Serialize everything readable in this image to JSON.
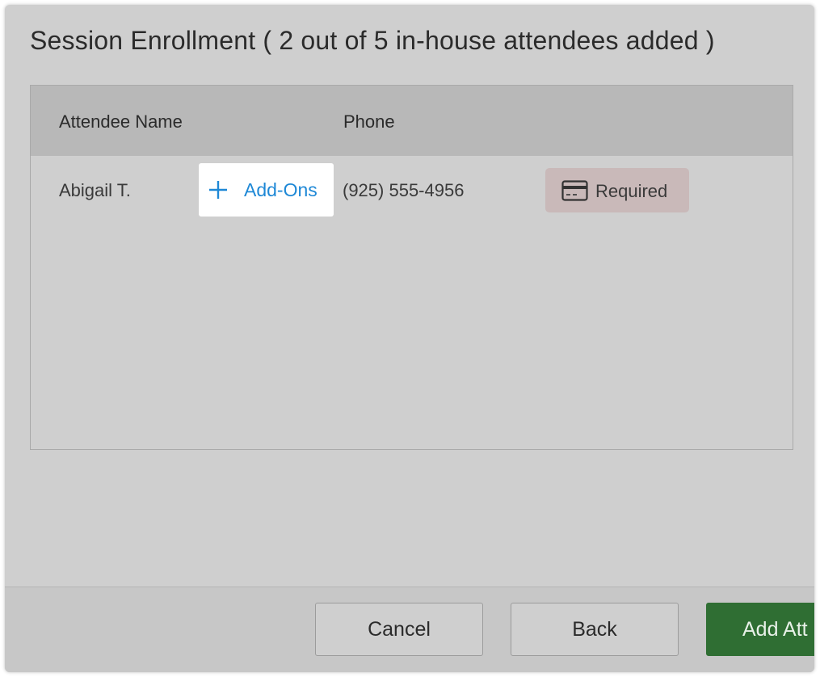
{
  "dialog": {
    "title": "Session Enrollment ( 2 out of 5 in-house attendees added )"
  },
  "table": {
    "columns": [
      "Attendee Name",
      "Phone"
    ],
    "rows": [
      {
        "name": "Abigail T.",
        "addons_label": "Add-Ons",
        "addons_icon": "plus-icon",
        "phone": "(925) 555-4956",
        "payment_status": "Required",
        "payment_icon": "credit-card-icon"
      }
    ]
  },
  "footer": {
    "cancel_label": "Cancel",
    "back_label": "Back",
    "add_label": "Add Att"
  },
  "colors": {
    "accent_link": "#1e88d6",
    "primary_button": "#2f6e33",
    "required_badge": "#c9b9b9"
  }
}
